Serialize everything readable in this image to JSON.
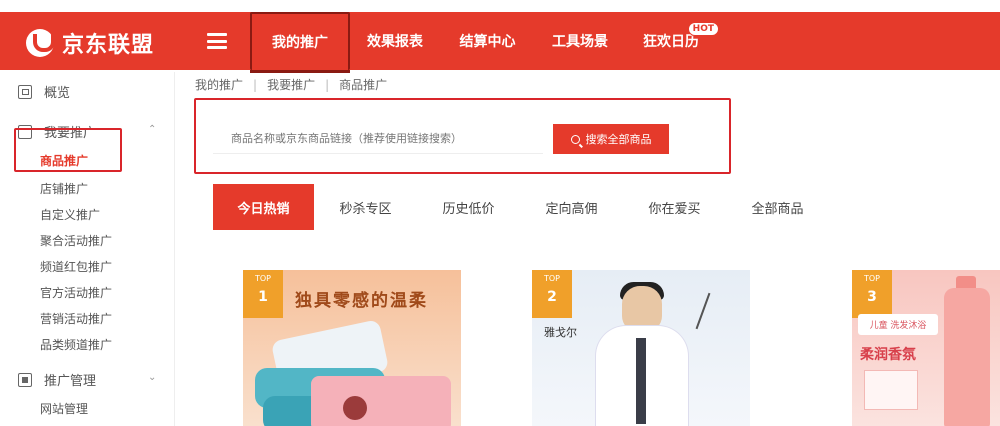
{
  "header": {
    "logo_text": "京东联盟",
    "nav": [
      {
        "label": "我的推广",
        "active": true
      },
      {
        "label": "效果报表",
        "active": false
      },
      {
        "label": "结算中心",
        "active": false
      },
      {
        "label": "工具场景",
        "active": false
      },
      {
        "label": "狂欢日历",
        "active": false,
        "badge": "HOT"
      }
    ]
  },
  "sidebar": {
    "overview": "概览",
    "my_promo": "我要推广",
    "promo_items": [
      "商品推广",
      "店铺推广",
      "自定义推广",
      "聚合活动推广",
      "频道红包推广",
      "官方活动推广",
      "营销活动推广",
      "品类频道推广"
    ],
    "promo_manage": "推广管理",
    "site_manage": "网站管理"
  },
  "breadcrumb": [
    "我的推广",
    "我要推广",
    "商品推广"
  ],
  "search": {
    "placeholder": "商品名称或京东商品链接（推荐使用链接搜索）",
    "button": "搜索全部商品"
  },
  "tabs": [
    {
      "label": "今日热销",
      "active": true
    },
    {
      "label": "秒杀专区",
      "active": false
    },
    {
      "label": "历史低价",
      "active": false
    },
    {
      "label": "定向高佣",
      "active": false
    },
    {
      "label": "你在爱买",
      "active": false
    },
    {
      "label": "全部商品",
      "active": false
    }
  ],
  "cards": [
    {
      "rank_top": "TOP",
      "rank": "1",
      "text": "独具零感的温柔"
    },
    {
      "rank_top": "TOP",
      "rank": "2",
      "brand": "雅戈尔"
    },
    {
      "rank_top": "TOP",
      "rank": "3",
      "label": "儿童 洗发沐浴",
      "title": "柔润香氛"
    }
  ],
  "colors": {
    "brand_red": "#e53a2b",
    "highlight_box": "#d9252a",
    "rank_badge": "#f0a02a"
  }
}
